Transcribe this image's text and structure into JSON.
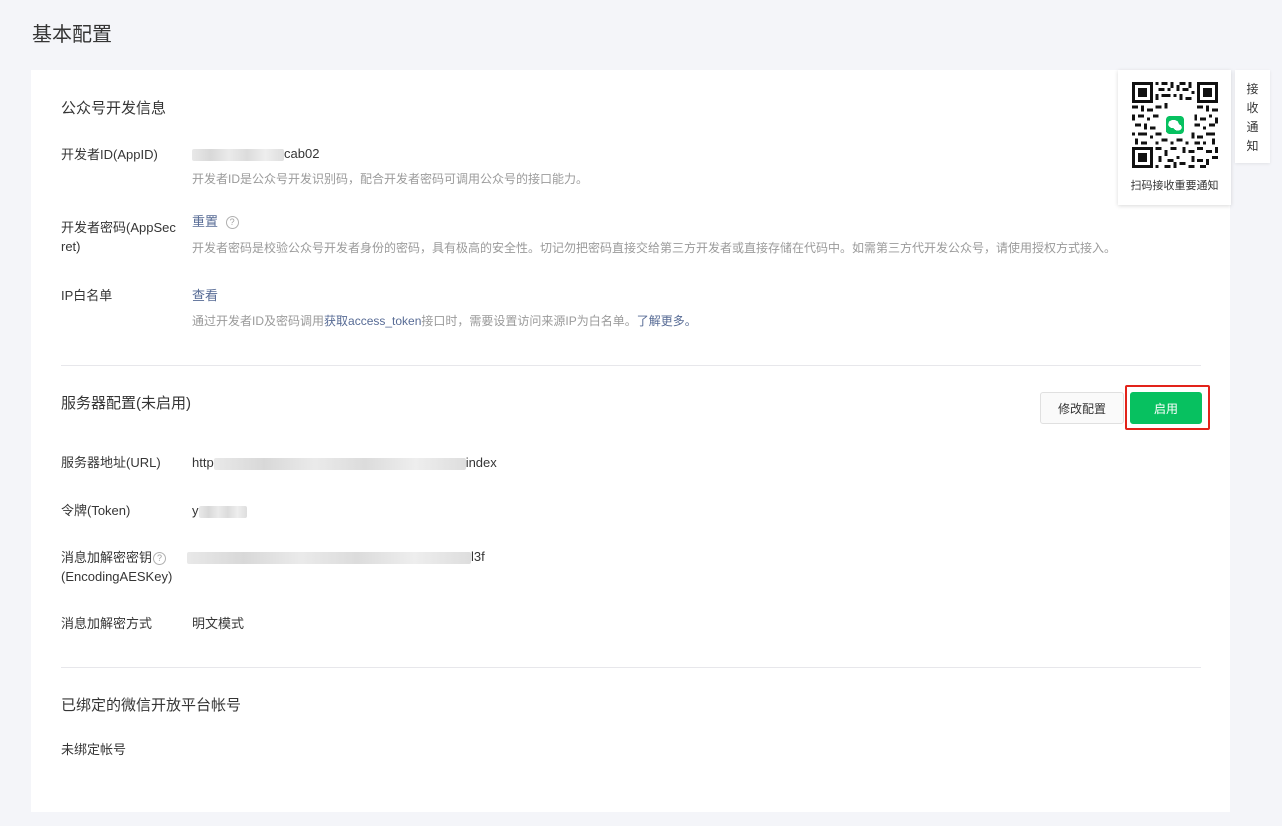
{
  "page": {
    "title": "基本配置"
  },
  "developer_info": {
    "section_title": "公众号开发信息",
    "app_id": {
      "label": "开发者ID(AppID)",
      "value_suffix": "cab02",
      "desc": "开发者ID是公众号开发识别码，配合开发者密码可调用公众号的接口能力。"
    },
    "app_secret": {
      "label_line1": "开发者密码(AppSec",
      "label_line2": "ret)",
      "action": "重置",
      "desc": "开发者密码是校验公众号开发者身份的密码，具有极高的安全性。切记勿把密码直接交给第三方开发者或直接存储在代码中。如需第三方代开发公众号，请使用授权方式接入。"
    },
    "ip_whitelist": {
      "label": "IP白名单",
      "action": "查看",
      "desc_prefix": "通过开发者ID及密码调用",
      "desc_link": "获取access_token",
      "desc_middle": "接口时，需要设置访问来源IP为白名单。",
      "desc_more": "了解更多。"
    }
  },
  "server_config": {
    "section_title": "服务器配置(未启用)",
    "modify_button": "修改配置",
    "enable_button": "启用",
    "url": {
      "label": "服务器地址(URL)",
      "prefix": "http",
      "suffix": "index"
    },
    "token": {
      "label": "令牌(Token)",
      "prefix": "y"
    },
    "aes_key": {
      "label_line1": "消息加解密密钥",
      "label_line2": "(EncodingAESKey)",
      "suffix": "l3f"
    },
    "encrypt_mode": {
      "label": "消息加解密方式",
      "value": "明文模式"
    }
  },
  "open_platform": {
    "section_title": "已绑定的微信开放平台帐号",
    "status": "未绑定帐号"
  },
  "qr_panel": {
    "caption": "扫码接收重要通知"
  },
  "side_tab": {
    "chars": [
      "接",
      "收",
      "通",
      "知"
    ]
  },
  "colors": {
    "accent": "#07c160",
    "link": "#576b95",
    "highlight": "#e2231a"
  }
}
